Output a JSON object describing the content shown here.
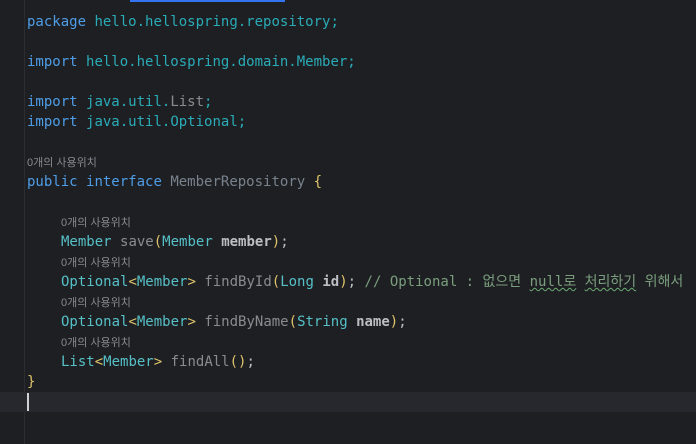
{
  "code": {
    "line1": {
      "kw": "package",
      "rest": "hello.hellospring.repository;"
    },
    "line3": {
      "kw": "import",
      "rest": "hello.hellospring.domain.Member;"
    },
    "line5": {
      "kw": "import",
      "pre": "java.util.",
      "cls": "List",
      "end": ";"
    },
    "line6": {
      "kw": "import",
      "pre": "java.util.",
      "cls": "Optional",
      "end": ";"
    },
    "hint_class": "0개의 사용위치",
    "line8": {
      "kw1": "public",
      "kw2": "interface",
      "name": "MemberRepository",
      "brace": "{"
    },
    "hint_save": "0개의 사용위치",
    "line11": {
      "type": "Member",
      "method": "save",
      "open": "(",
      "ptype": "Member",
      "pname": "member",
      "close": ")",
      "end": ";"
    },
    "hint_findById": "0개의 사용위치",
    "line13": {
      "type": "Optional",
      "lt": "<",
      "gen": "Member",
      "gt": ">",
      "method": "findById",
      "open": "(",
      "ptype": "Long",
      "pname": "id",
      "close": ")",
      "end": ";",
      "comment_pre": "// Optional : 없으면 ",
      "comment_null": "null로",
      "comment_mid": " ",
      "comment_ch": "처리하기",
      "comment_end": " 위해서"
    },
    "hint_findByName": "0개의 사용위치",
    "line15": {
      "type": "Optional",
      "lt": "<",
      "gen": "Member",
      "gt": ">",
      "method": "findByName",
      "open": "(",
      "ptype": "String",
      "pname": "name",
      "close": ")",
      "end": ";"
    },
    "hint_findAll": "0개의 사용위치",
    "line17": {
      "type": "List",
      "lt": "<",
      "gen": "Member",
      "gt": ">",
      "method": "findAll",
      "parens": "()",
      "end": ";"
    },
    "line18": {
      "brace": "}"
    }
  }
}
